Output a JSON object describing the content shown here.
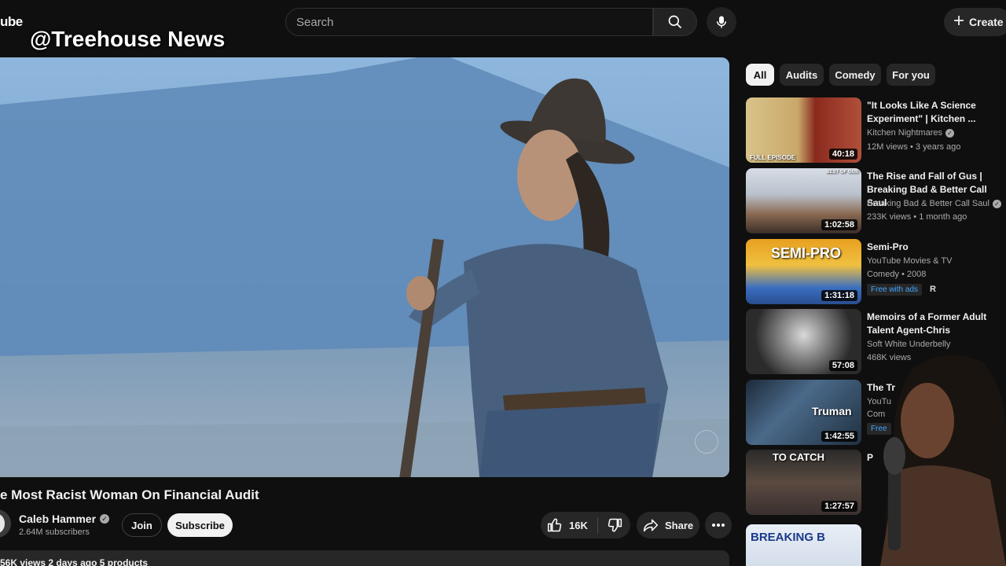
{
  "header": {
    "logo_fragment": "ube",
    "watermark": "@Treehouse News",
    "search_placeholder": "Search",
    "create_label": "Create"
  },
  "video": {
    "title": "e Most Racist Woman On Financial Audit",
    "channel": "Caleb Hammer",
    "subscribers": "2.64M subscribers",
    "join_label": "Join",
    "subscribe_label": "Subscribe",
    "likes": "16K",
    "share_label": "Share",
    "meta": "56K views  2 days ago  5 products"
  },
  "chips": [
    "All",
    "Audits",
    "Comedy",
    "For you"
  ],
  "recommendations": [
    {
      "title": "\"It Looks Like A Science Experiment\" | Kitchen ...",
      "channel": "Kitchen Nightmares",
      "verified": true,
      "meta": "12M views • 3 years ago",
      "duration": "40:18",
      "thumb_text": "FULL EPISODE"
    },
    {
      "title": "The Rise and Fall of Gus | Breaking Bad & Better Call Saul",
      "channel": "Breaking Bad & Better Call Saul",
      "verified": true,
      "meta": "233K views • 1 month ago",
      "duration": "1:02:58",
      "thumb_text": "BEST OF GUS"
    },
    {
      "title": "Semi-Pro",
      "channel": "YouTube Movies & TV",
      "verified": false,
      "meta": "Comedy • 2008",
      "duration": "1:31:18",
      "thumb_text": "SEMI-PRO",
      "badge": "Free with ads",
      "rating": "R"
    },
    {
      "title": "Memoirs of a Former Adult Talent Agent-Chris",
      "channel": "Soft White Underbelly",
      "verified": false,
      "meta": "468K views",
      "duration": "57:08",
      "thumb_text": ""
    },
    {
      "title": "The Tr",
      "channel": "YouTu",
      "verified": false,
      "meta": "Com",
      "duration": "1:42:55",
      "thumb_text": "Truman",
      "badge": "Free"
    },
    {
      "title": "P",
      "channel": "",
      "verified": false,
      "meta": "",
      "duration": "1:27:57",
      "thumb_text": "TO CATCH"
    },
    {
      "title": "",
      "channel": "",
      "verified": false,
      "meta": "",
      "duration": "",
      "thumb_text": "BREAKING B"
    }
  ]
}
